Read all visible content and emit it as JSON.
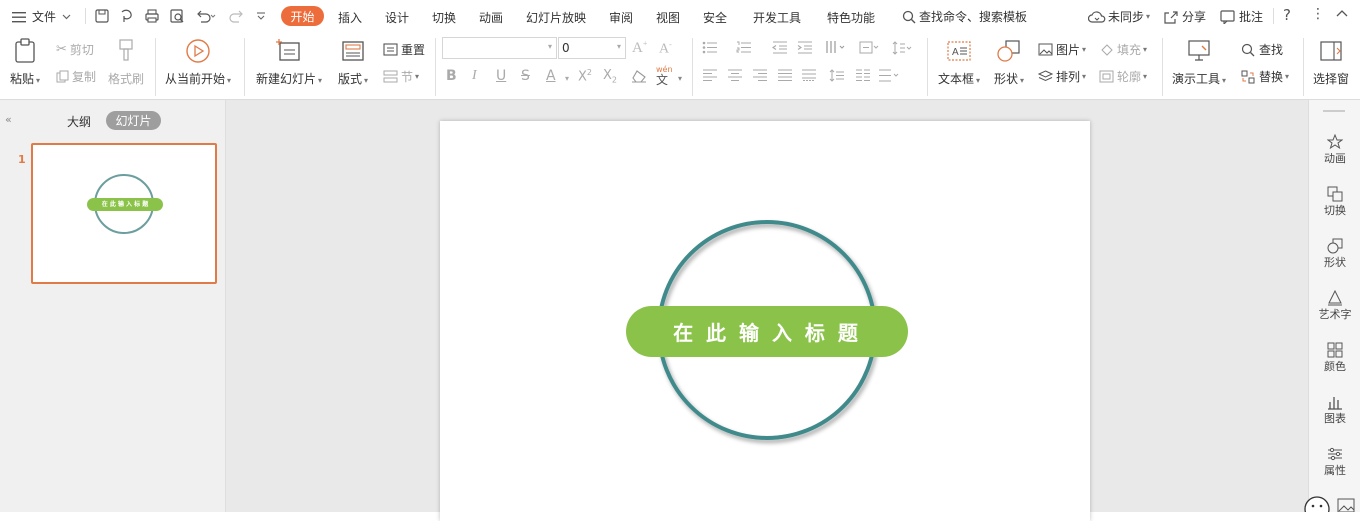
{
  "menubar": {
    "file_label": "文件",
    "tabs": [
      "开始",
      "插入",
      "设计",
      "切换",
      "动画",
      "幻灯片放映",
      "审阅",
      "视图",
      "安全",
      "开发工具",
      "特色功能"
    ],
    "search_label": "查找命令、搜索模板",
    "sync_label": "未同步",
    "share_label": "分享",
    "comment_label": "批注"
  },
  "ribbon": {
    "paste": "粘贴",
    "cut": "剪切",
    "copy": "复制",
    "format_painter": "格式刷",
    "from_current": "从当前开始",
    "new_slide": "新建幻灯片",
    "layout": "版式",
    "reset": "重置",
    "section": "节",
    "font_size": "0",
    "textbox": "文本框",
    "shape": "形状",
    "picture": "图片",
    "fill": "填充",
    "arrange": "排列",
    "outline": "轮廓",
    "present_tools": "演示工具",
    "find": "查找",
    "replace": "替换",
    "select_pane": "选择窗"
  },
  "leftpanel": {
    "outline_tab": "大纲",
    "slides_tab": "幻灯片",
    "slide_number": "1"
  },
  "slide": {
    "title_text": "在 此 输 入 标 题"
  },
  "rightbar": {
    "items": [
      "动画",
      "切换",
      "形状",
      "艺术字",
      "颜色",
      "图表",
      "属性"
    ]
  },
  "colors": {
    "accent_tab": "#ec6d3b",
    "ring": "#3f8a8c",
    "banner": "#8bc34a",
    "thumb_border": "#e07b47"
  }
}
